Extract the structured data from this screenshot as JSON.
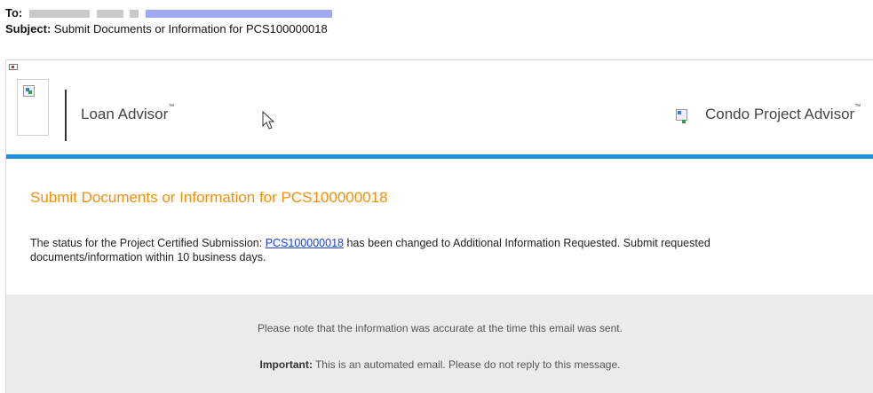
{
  "email": {
    "to_label": "To:",
    "subject_label": "Subject:",
    "subject": "Submit Documents or Information for PCS100000018"
  },
  "brand": {
    "left_name": "Loan Advisor",
    "left_tm": "™",
    "right_name": "Condo Project Advisor",
    "right_tm": "™",
    "accent_color": "#1e8fd8"
  },
  "message": {
    "heading": "Submit Documents or Information for PCS100000018",
    "heading_color": "#f0900a",
    "text_before_link": "The status for the Project Certified Submission: ",
    "link_text": "PCS100000018",
    "text_after_link": " has been changed to Additional Information Requested. Submit requested documents/information within 10 business days."
  },
  "footer": {
    "note": "Please note that the information was accurate at the time this email was sent.",
    "important_label": "Important:",
    "important_text": " This is an automated email. Please do not reply to this message."
  }
}
